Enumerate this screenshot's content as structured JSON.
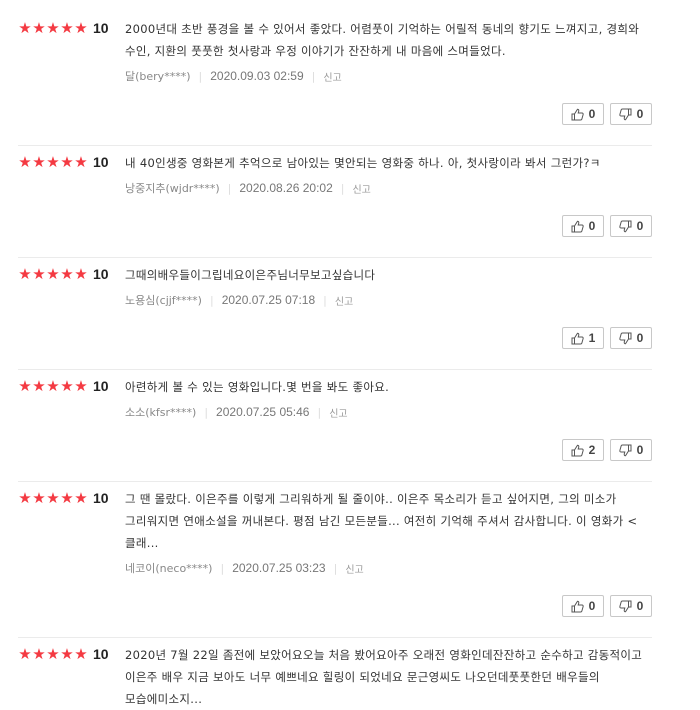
{
  "colors": {
    "star": "#f43a42",
    "divider": "#ebebeb",
    "border": "#c8c8c8"
  },
  "icons": {
    "up": "thumbs-up-icon",
    "down": "thumbs-down-icon",
    "star": "star-icon"
  },
  "reviews": [
    {
      "rating_stars": 5,
      "score": "10",
      "text": "2000년대 초반 풍경을 볼 수 있어서 좋았다. 어렴풋이 기억하는 어릴적 동네의 향기도 느껴지고, 경희와 수인, 지환의 풋풋한 첫사랑과 우정 이야기가 잔잔하게 내 마음에 스며들었다.",
      "writer": "달(bery****)",
      "date": "2020.09.03 02:59",
      "report": "신고",
      "up": "0",
      "down": "0"
    },
    {
      "rating_stars": 5,
      "score": "10",
      "text": "내 40인생중 영화본게 추억으로 남아있는 몇안되는 영화중 하나. 아, 첫사랑이라 봐서 그런가?ㅋ",
      "writer": "낭중지추(wjdr****)",
      "date": "2020.08.26 20:02",
      "report": "신고",
      "up": "0",
      "down": "0"
    },
    {
      "rating_stars": 5,
      "score": "10",
      "text": "그때의배우들이그립네요이은주님너무보고싶습니다",
      "writer": "노용심(cjjf****)",
      "date": "2020.07.25 07:18",
      "report": "신고",
      "up": "1",
      "down": "0"
    },
    {
      "rating_stars": 5,
      "score": "10",
      "text": "아련하게 볼 수 있는 영화입니다.몇 번을 봐도 좋아요.",
      "writer": "소소(kfsr****)",
      "date": "2020.07.25 05:46",
      "report": "신고",
      "up": "2",
      "down": "0"
    },
    {
      "rating_stars": 5,
      "score": "10",
      "text": "그 땐 몰랐다. 이은주를 이렇게 그리워하게 될 줄이야.. 이은주 목소리가 듣고 싶어지면, 그의 미소가 그리워지면 연애소설을 꺼내본다. 평점 남긴 모든분들... 여전히 기억해 주셔서 감사합니다. 이 영화가 <클래...",
      "writer": "네코이(neco****)",
      "date": "2020.07.25 03:23",
      "report": "신고",
      "up": "0",
      "down": "0"
    },
    {
      "rating_stars": 5,
      "score": "10",
      "text": "2020년 7월 22일 좀전에 보았어요오늘 처음 봤어요아주 오래전 영화인데잔잔하고 순수하고 감동적이고 이은주 배우 지금 보아도 너무 예쁘네요 힐링이 되었네요 문근영씨도 나오던데풋풋한던 배우들의 모습에미소지...",
      "writer": "",
      "date": "",
      "report": "",
      "up": "",
      "down": ""
    }
  ]
}
